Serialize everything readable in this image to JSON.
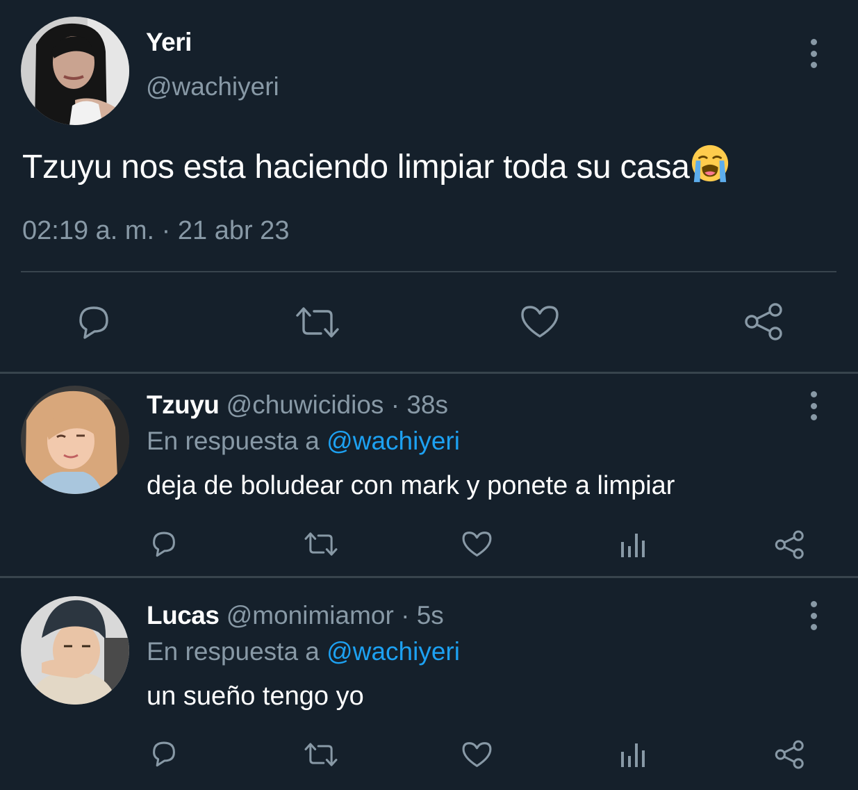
{
  "main_tweet": {
    "author_name": "Yeri",
    "author_handle": "@wachiyeri",
    "text": "Tzuyu nos esta haciendo limpiar toda su casa",
    "emoji": "loudly-crying-face",
    "timestamp": "02:19 a. m. · 21 abr 23",
    "actions": [
      "reply-icon",
      "retweet-icon",
      "like-icon",
      "share-icon"
    ]
  },
  "replies": [
    {
      "author_name": "Tzuyu",
      "author_handle": "@chuwicidios",
      "time": "· 38s",
      "reply_prefix": "En respuesta a",
      "reply_mention": "@wachiyeri",
      "text": "deja de boludear con mark y ponete a limpiar"
    },
    {
      "author_name": "Lucas",
      "author_handle": "@monimiamor",
      "time": "· 5s",
      "reply_prefix": "En respuesta a",
      "reply_mention": "@wachiyeri",
      "text": "un sueño tengo yo"
    }
  ],
  "colors": {
    "background": "#15202b",
    "secondary_text": "#8899a6",
    "mention": "#1da1f2",
    "divider": "#38444d"
  }
}
